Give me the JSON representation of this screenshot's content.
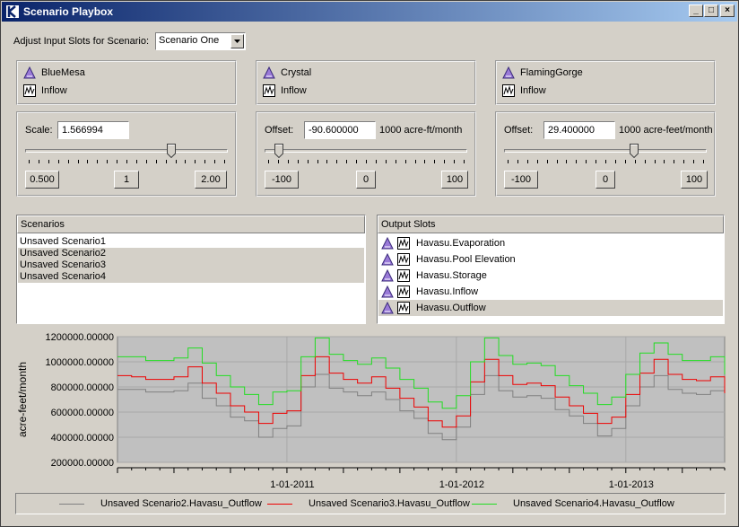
{
  "window": {
    "title": "Scenario Playbox"
  },
  "adjust": {
    "label": "Adjust Input Slots for Scenario:",
    "selected": "Scenario One"
  },
  "panels": [
    {
      "object": "BlueMesa",
      "slot": "Inflow",
      "mode_label": "Scale:",
      "value": "1.566994",
      "units": "",
      "btn_left": "0.500",
      "btn_mid": "1",
      "btn_right": "2.00",
      "position": 0.73
    },
    {
      "object": "Crystal",
      "slot": "Inflow",
      "mode_label": "Offset:",
      "value": "-90.600000",
      "units": "1000 acre-ft/month",
      "btn_left": "-100",
      "btn_mid": "0",
      "btn_right": "100",
      "position": 0.05
    },
    {
      "object": "FlamingGorge",
      "slot": "Inflow",
      "mode_label": "Offset:",
      "value": "29.400000",
      "units": "1000 acre-feet/month",
      "btn_left": "-100",
      "btn_mid": "0",
      "btn_right": "100",
      "position": 0.65
    }
  ],
  "scenarios": {
    "header": "Scenarios",
    "items": [
      "Unsaved Scenario1",
      "Unsaved Scenario2",
      "Unsaved Scenario3",
      "Unsaved Scenario4"
    ],
    "selected": [
      1,
      2,
      3
    ]
  },
  "output_slots": {
    "header": "Output Slots",
    "items": [
      "Havasu.Evaporation",
      "Havasu.Pool Elevation",
      "Havasu.Storage",
      "Havasu.Inflow",
      "Havasu.Outflow"
    ],
    "selected": 4
  },
  "chart_data": {
    "type": "line",
    "ylabel": "acre-feet/month",
    "ylim": [
      200000,
      1200000
    ],
    "yticks": [
      "1200000.00000",
      "1000000.00000",
      "800000.00000",
      "600000.00000",
      "400000.00000",
      "200000.00000"
    ],
    "ytick_values": [
      1200000,
      1000000,
      800000,
      600000,
      400000,
      200000
    ],
    "xlabels": [
      "1-01-2011",
      "1-01-2012",
      "1-01-2013"
    ],
    "xlabel_months": [
      12,
      24,
      36
    ],
    "months": 43,
    "series": [
      {
        "name": "Unsaved Scenario2.Havasu_Outflow",
        "color": "#808080",
        "values": [
          780000,
          780000,
          760000,
          760000,
          770000,
          830000,
          710000,
          650000,
          560000,
          530000,
          400000,
          470000,
          490000,
          800000,
          900000,
          790000,
          760000,
          730000,
          760000,
          700000,
          610000,
          550000,
          430000,
          380000,
          480000,
          740000,
          890000,
          770000,
          720000,
          730000,
          710000,
          620000,
          570000,
          510000,
          410000,
          470000,
          650000,
          800000,
          890000,
          780000,
          750000,
          740000,
          770000,
          630000
        ]
      },
      {
        "name": "Unsaved Scenario3.Havasu_Outflow",
        "color": "#ee0000",
        "values": [
          890000,
          880000,
          860000,
          860000,
          880000,
          960000,
          830000,
          750000,
          650000,
          600000,
          510000,
          590000,
          610000,
          890000,
          1040000,
          910000,
          860000,
          830000,
          880000,
          790000,
          710000,
          640000,
          530000,
          480000,
          570000,
          840000,
          1020000,
          890000,
          820000,
          830000,
          810000,
          720000,
          650000,
          590000,
          510000,
          560000,
          740000,
          910000,
          1020000,
          900000,
          860000,
          850000,
          880000,
          750000
        ]
      },
      {
        "name": "Unsaved Scenario4.Havasu_Outflow",
        "color": "#22dd22",
        "values": [
          1040000,
          1040000,
          1010000,
          1010000,
          1030000,
          1110000,
          990000,
          890000,
          800000,
          740000,
          660000,
          760000,
          770000,
          1040000,
          1190000,
          1060000,
          1010000,
          980000,
          1030000,
          950000,
          860000,
          790000,
          680000,
          630000,
          730000,
          1000000,
          1190000,
          1050000,
          980000,
          990000,
          970000,
          890000,
          810000,
          750000,
          660000,
          720000,
          900000,
          1070000,
          1150000,
          1060000,
          1010000,
          1010000,
          1040000,
          900000
        ]
      }
    ]
  },
  "legend": {
    "items": [
      {
        "label": "Unsaved Scenario2.Havasu_Outflow",
        "color": "#808080"
      },
      {
        "label": "Unsaved Scenario3.Havasu_Outflow",
        "color": "#ee0000"
      },
      {
        "label": "Unsaved Scenario4.Havasu_Outflow",
        "color": "#22dd22"
      }
    ]
  }
}
